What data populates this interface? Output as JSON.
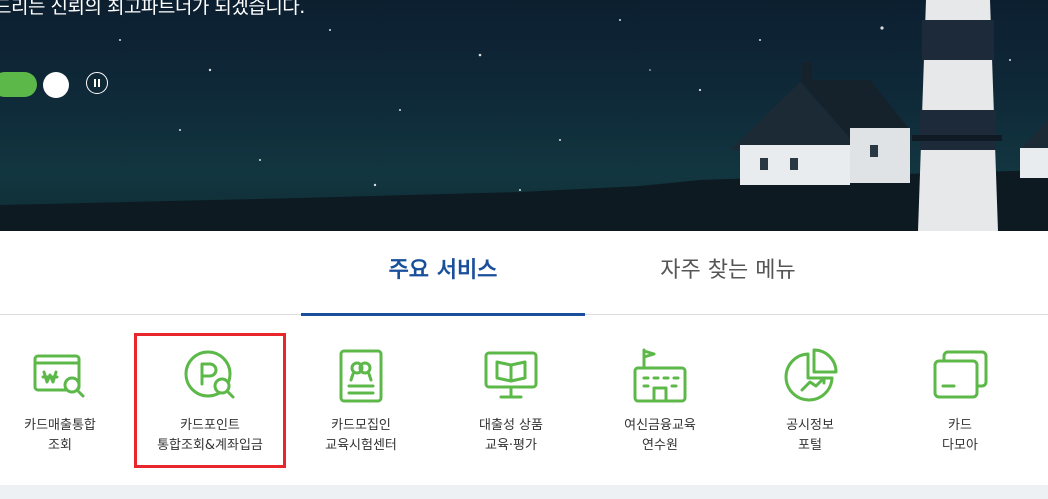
{
  "hero": {
    "headline": "드리는 신뢰의 최고파트너가 되겠습니다."
  },
  "tabs": [
    {
      "label": "주요 서비스",
      "active": true
    },
    {
      "label": "자주 찾는 메뉴",
      "active": false
    }
  ],
  "services": [
    {
      "line1": "카드매출통합",
      "line2": "조회",
      "icon": "card-sales-search-icon"
    },
    {
      "line1": "카드포인트",
      "line2": "통합조회&계좌입금",
      "icon": "point-search-icon"
    },
    {
      "line1": "카드모집인",
      "line2": "교육시험센터",
      "icon": "recruiter-certificate-icon"
    },
    {
      "line1": "대출성 상품",
      "line2": "교육·평가",
      "icon": "education-monitor-icon"
    },
    {
      "line1": "여신금융교육",
      "line2": "연수원",
      "icon": "training-building-icon"
    },
    {
      "line1": "공시정보",
      "line2": "포털",
      "icon": "disclosure-chart-icon"
    },
    {
      "line1": "카드",
      "line2": "다모아",
      "icon": "card-stack-icon"
    }
  ],
  "colors": {
    "accent_green": "#5cb848",
    "active_tab_blue": "#1a4f9c",
    "highlight_red": "#e8262b"
  }
}
